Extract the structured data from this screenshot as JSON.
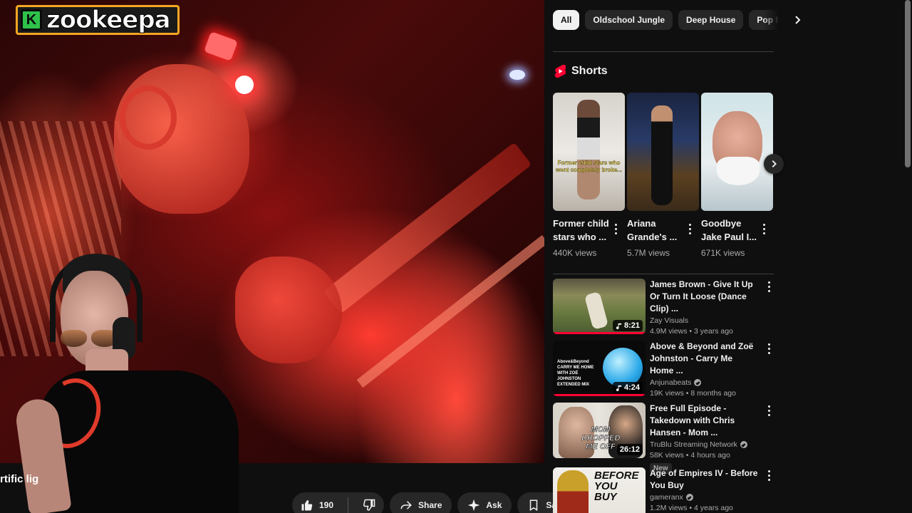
{
  "overlay": {
    "logo_mark": "K",
    "logo_text": "zookeepa"
  },
  "video": {
    "title_fragment": "rtific        lig"
  },
  "actions": {
    "like_count": "190",
    "share_label": "Share",
    "ask_label": "Ask",
    "save_label": "Save"
  },
  "chips": [
    {
      "label": "All",
      "active": true
    },
    {
      "label": "Oldschool Jungle",
      "active": false
    },
    {
      "label": "Deep House",
      "active": false
    },
    {
      "label": "Pop M",
      "active": false
    }
  ],
  "shorts": {
    "heading": "Shorts",
    "items": [
      {
        "title": "Former child stars who ...",
        "views": "440K views",
        "caption": "Former child stars who went completely broke..."
      },
      {
        "title": "Ariana Grande's ...",
        "views": "5.7M views"
      },
      {
        "title": "Goodbye Jake Paul I...",
        "views": "671K views"
      }
    ]
  },
  "recommendations": [
    {
      "title": "James Brown - Give It Up Or Turn It Loose (Dance Clip) ...",
      "channel": "Zay Visuals",
      "verified": false,
      "meta": "4.9M views • 3 years ago",
      "duration": "8:21",
      "music_icon": "music-note-icon",
      "progress": 1.0
    },
    {
      "title": "Above & Beyond and Zoë Johnston - Carry Me Home ...",
      "channel": "Anjunabeats",
      "verified": true,
      "meta": "19K views • 8 months ago",
      "duration": "4:24",
      "music_icon": "music-note-icon",
      "progress": 1.0,
      "thumb_text": "Above&Beyond CARRY ME HOME WITH ZOË JOHNSTON EXTENDED MIX"
    },
    {
      "title": "Free Full Episode - Takedown with Chris Hansen - Mom ...",
      "channel": "TruBlu Streaming Network",
      "verified": true,
      "meta": "58K views • 4 hours ago",
      "duration": "26:12",
      "badge": "New",
      "thumb_text": "MOM DROPPED ME OFF"
    },
    {
      "title": "Age of Empires IV - Before You Buy",
      "channel": "gameranx",
      "verified": true,
      "meta": "1.2M views • 4 years ago",
      "thumb_text": "BEFORE YOU BUY"
    }
  ],
  "colors": {
    "background": "#0f0f0f",
    "chip_bg": "#272727",
    "accent_red": "#ff0033",
    "logo_green": "#2ec24a",
    "logo_border": "#f5a623"
  }
}
